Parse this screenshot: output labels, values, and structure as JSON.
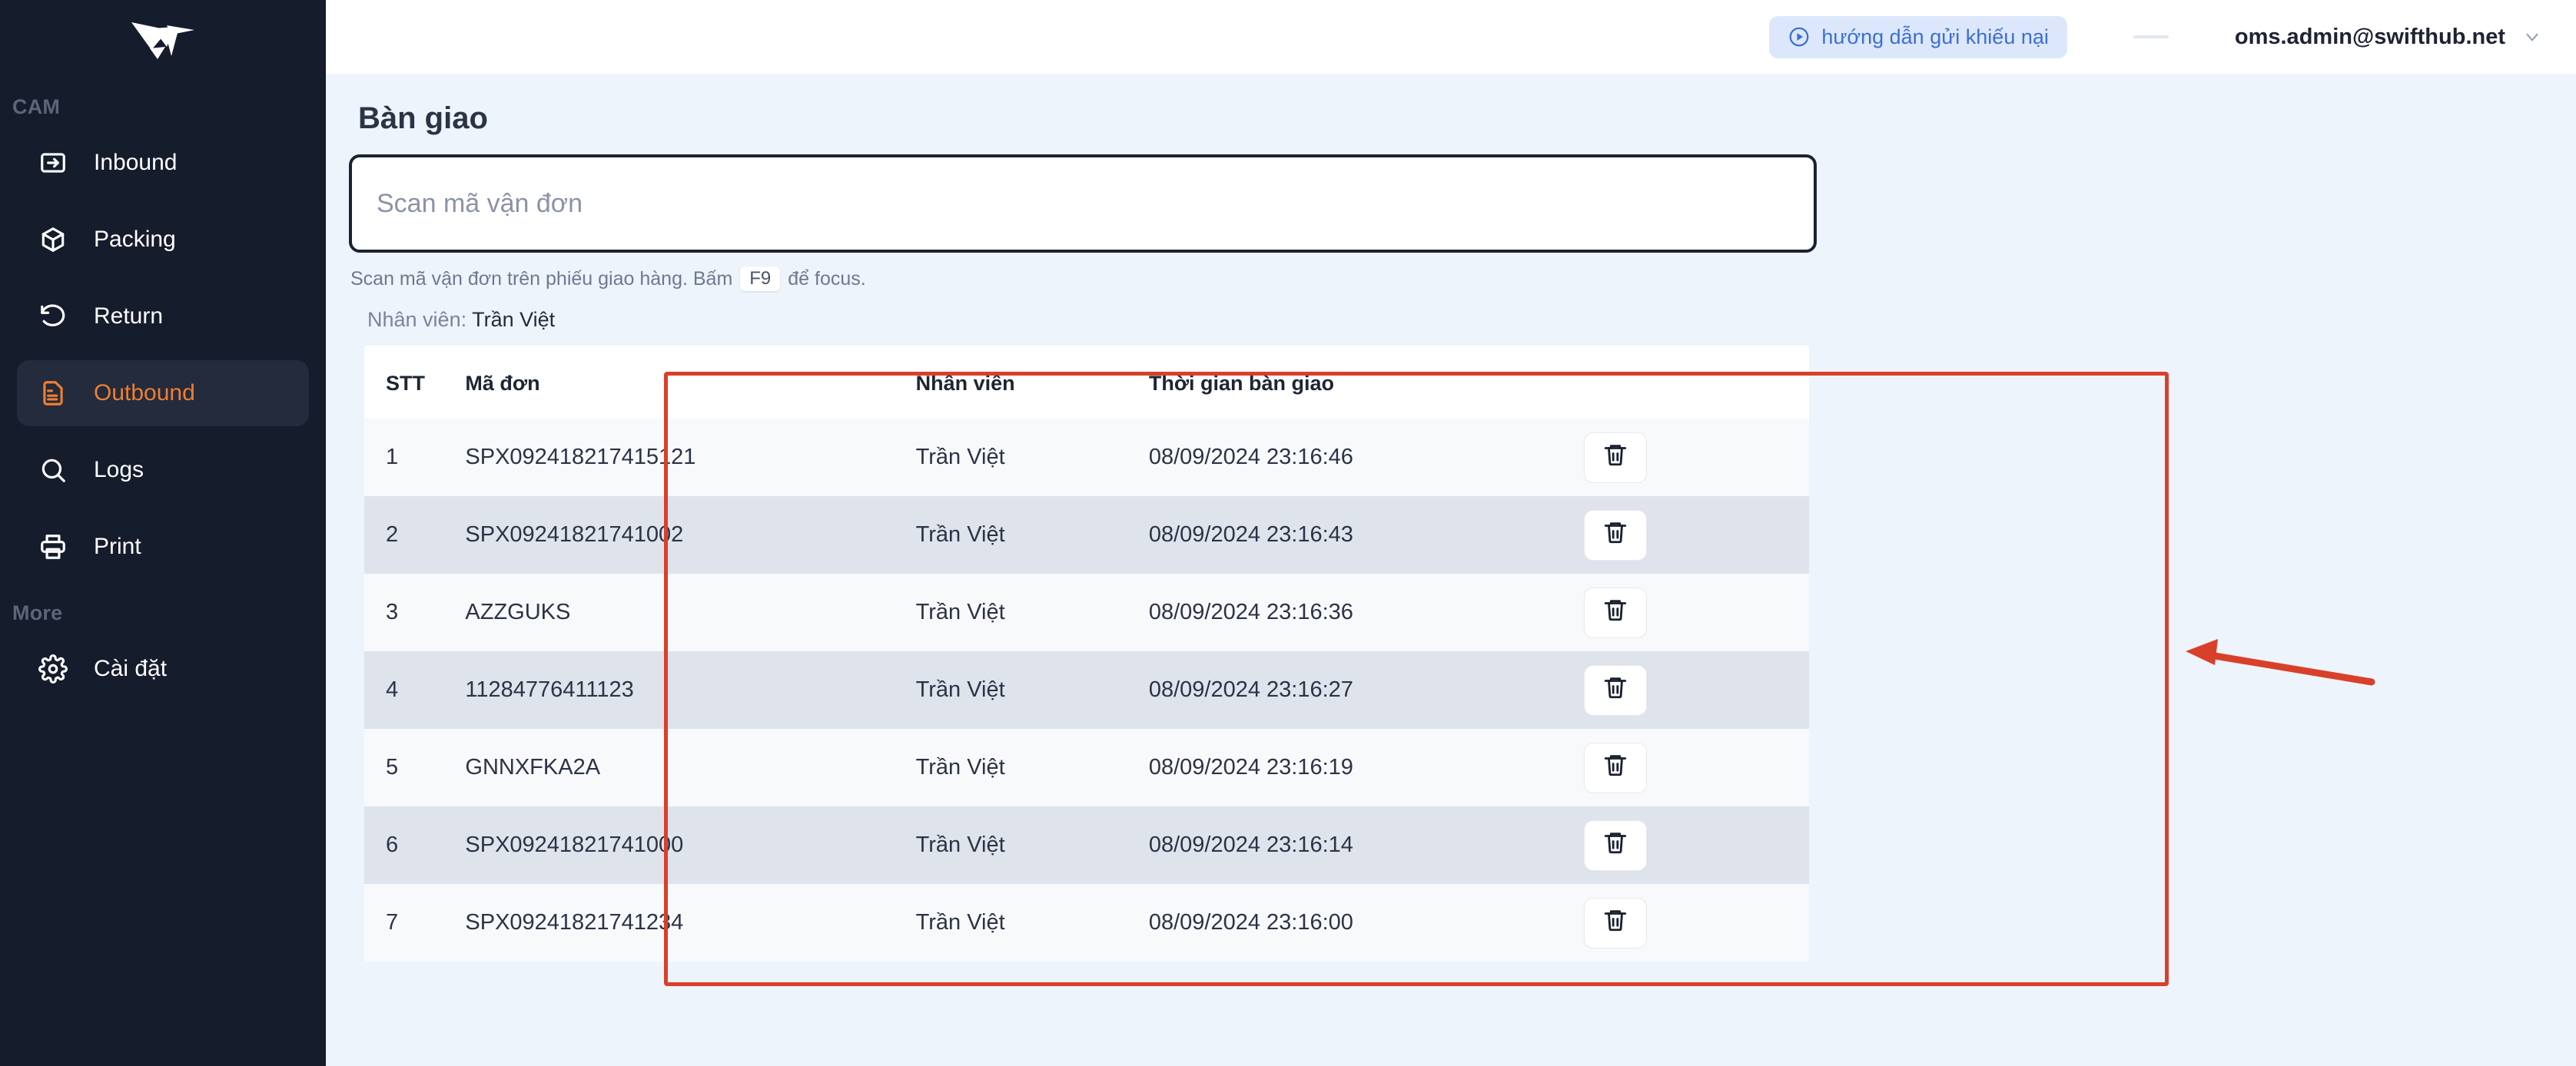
{
  "sidebar": {
    "logo_name": "swifthub-bird-logo",
    "sections": [
      {
        "label": "CAM",
        "items": [
          {
            "label": "Inbound",
            "icon": "inbound-arrow-icon",
            "active": false
          },
          {
            "label": "Packing",
            "icon": "box-icon",
            "active": false
          },
          {
            "label": "Return",
            "icon": "undo-arrow-icon",
            "active": false
          },
          {
            "label": "Outbound",
            "icon": "document-lines-icon",
            "active": true
          },
          {
            "label": "Logs",
            "icon": "search-icon",
            "active": false
          },
          {
            "label": "Print",
            "icon": "printer-icon",
            "active": false
          }
        ]
      },
      {
        "label": "More",
        "items": [
          {
            "label": "Cài đặt",
            "icon": "gear-icon",
            "active": false
          }
        ]
      }
    ]
  },
  "topbar": {
    "guide_label": "hướng dẫn gửi khiếu nại",
    "guide_icon": "play-circle-icon",
    "account_email": "oms.admin@swifthub.net",
    "caret_icon": "chevron-down-icon"
  },
  "main": {
    "page_title": "Bàn giao",
    "scan_input_placeholder": "Scan mã vận đơn",
    "scan_input_value": "",
    "hint_before": "Scan mã vận đơn trên phiếu giao hàng. Bấm",
    "hint_key": "F9",
    "hint_after": "để focus.",
    "staff_label": "Nhân viên:",
    "staff_value": "Trần Việt"
  },
  "table": {
    "columns": [
      "STT",
      "Mã đơn",
      "Nhân viên",
      "Thời gian bàn giao",
      ""
    ],
    "delete_icon": "trash-icon",
    "rows": [
      {
        "stt": "1",
        "code": "SPX092418217415121",
        "staff": "Trần Việt",
        "time": "08/09/2024 23:16:46"
      },
      {
        "stt": "2",
        "code": "SPX09241821741002",
        "staff": "Trần Việt",
        "time": "08/09/2024 23:16:43"
      },
      {
        "stt": "3",
        "code": "AZZGUKS",
        "staff": "Trần Việt",
        "time": "08/09/2024 23:16:36"
      },
      {
        "stt": "4",
        "code": "11284776411123",
        "staff": "Trần Việt",
        "time": "08/09/2024 23:16:27"
      },
      {
        "stt": "5",
        "code": "GNNXFKA2A",
        "staff": "Trần Việt",
        "time": "08/09/2024 23:16:19"
      },
      {
        "stt": "6",
        "code": "SPX09241821741000",
        "staff": "Trần Việt",
        "time": "08/09/2024 23:16:14"
      },
      {
        "stt": "7",
        "code": "SPX09241821741234",
        "staff": "Trần Việt",
        "time": "08/09/2024 23:16:00"
      }
    ]
  },
  "annotation": {
    "highlight_color": "#d9402a",
    "arrow_color": "#d9402a",
    "arrow_name": "red-pointer-arrow"
  },
  "colors": {
    "sidebar_bg": "#151c2c",
    "accent_orange": "#ef7f31",
    "page_bg": "#eef4fc",
    "chip_bg": "#dde7fb",
    "chip_text": "#3b6fd4",
    "row_odd": "#f8f9fb",
    "row_even": "#dfe3eb"
  }
}
